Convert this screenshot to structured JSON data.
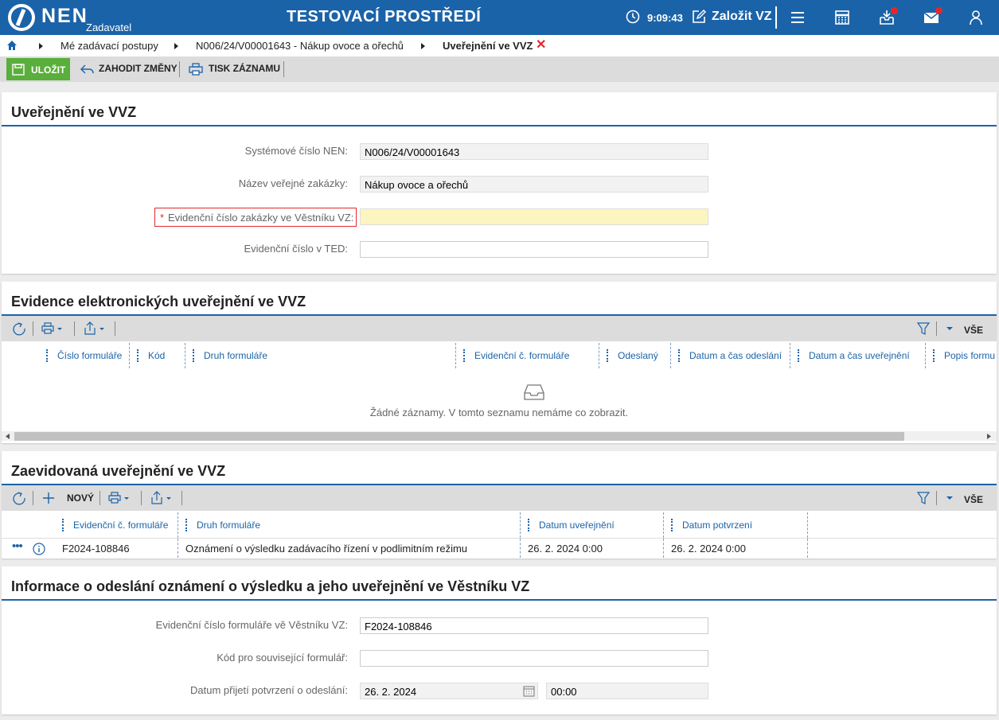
{
  "app": {
    "logo": "NEN",
    "logo_sub": "Zadavatel",
    "env_title": "TESTOVACÍ PROSTŘEDÍ",
    "time": "9:09:43",
    "create_label": "Založit VZ",
    "icons": [
      "clock-icon",
      "edit-icon",
      "menu-icon",
      "calculator-icon",
      "inbox-icon",
      "mail-icon",
      "user-icon"
    ]
  },
  "breadcrumb": {
    "items": [
      "Mé zadávací postupy",
      "N006/24/V00001643 - Nákup ovoce a ořechů",
      "Uveřejnění ve VVZ"
    ]
  },
  "actions": {
    "save": "ULOŽIT",
    "discard": "ZAHODIT ZMĚNY",
    "print": "TISK ZÁZNAMU"
  },
  "section1": {
    "title": "Uveřejnění ve VVZ",
    "fields": [
      {
        "label": "Systémové číslo NEN:",
        "value": "N006/24/V00001643"
      },
      {
        "label": "Název veřejné zakázky:",
        "value": "Nákup ovoce a ořechů"
      },
      {
        "label": "Evidenční číslo zakázky ve Věstníku VZ:",
        "value": "",
        "required": true
      },
      {
        "label": "Evidenční číslo v TED:",
        "value": ""
      }
    ]
  },
  "section2": {
    "title": "Evidence elektronických uveřejnění ve VVZ",
    "filter_label": "VŠE",
    "columns": [
      "Číslo formuláře",
      "Kód",
      "Druh formuláře",
      "Evidenční č. formuláře",
      "Odeslaný",
      "Datum a čas odeslání",
      "Datum a čas uveřejnění",
      "Popis formu"
    ],
    "empty": "Žádné záznamy. V tomto seznamu nemáme co zobrazit."
  },
  "section3": {
    "title": "Zaevidovaná uveřejnění ve VVZ",
    "new_label": "NOVÝ",
    "filter_label": "VŠE",
    "columns": [
      "Evidenční č. formuláře",
      "Druh formuláře",
      "Datum uveřejnění",
      "Datum potvrzení"
    ],
    "rows": [
      {
        "ev": "F2024-108846",
        "druh": "Oznámení o výsledku zadávacího řízení v podlimitním režimu",
        "uver": "26. 2. 2024 0:00",
        "potv": "26. 2. 2024 0:00"
      }
    ]
  },
  "section4": {
    "title": "Informace o odeslání oznámení o výsledku a jeho uveřejnění ve Věstníku VZ",
    "fields": [
      {
        "label": "Evidenční číslo formuláře vě Věstníku VZ:",
        "value": "F2024-108846"
      },
      {
        "label": "Kód pro související formulář:",
        "value": ""
      },
      {
        "label": "Datum přijetí potvrzení o odeslání:",
        "date": "26. 2. 2024",
        "time": "00:00"
      }
    ]
  },
  "colors": {
    "brand": "#1b63a8",
    "save": "#5aae3c",
    "required": "#e3282b",
    "required_bg": "#fdf5bf"
  }
}
